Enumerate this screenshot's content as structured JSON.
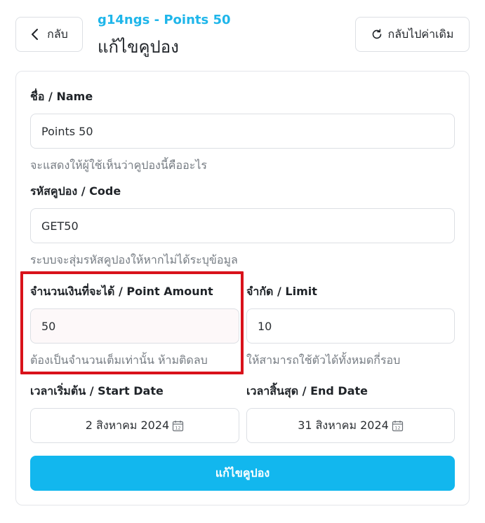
{
  "header": {
    "back_label": "กลับ",
    "breadcrumb": "g14ngs - Points 50",
    "title": "แก้ไขคูปอง",
    "reset_label": "กลับไปค่าเดิม"
  },
  "form": {
    "name": {
      "label": "ชื่อ / Name",
      "value": "Points 50",
      "hint": "จะแสดงให้ผู้ใช้เห็นว่าคูปองนี้คืออะไร"
    },
    "code": {
      "label": "รหัสคูปอง / Code",
      "value": "GET50",
      "hint": "ระบบจะสุ่มรหัสคูปองให้หากไม่ได้ระบุข้อมูล"
    },
    "point_amount": {
      "label": "จำนวนเงินที่จะได้ / Point Amount",
      "value": "50",
      "hint": "ต้องเป็นจำนวนเต็มเท่านั้น ห้ามติดลบ"
    },
    "limit": {
      "label": "จำกัด / Limit",
      "value": "10",
      "hint": "ให้สามารถใช้ตัวได้ทั้งหมดกี่รอบ"
    },
    "start_date": {
      "label": "เวลาเริ่มต้น / Start Date",
      "value": "2 สิงหาคม 2024"
    },
    "end_date": {
      "label": "เวลาสิ้นสุด / End Date",
      "value": "31 สิงหาคม 2024"
    },
    "submit_label": "แก้ไขคูปอง"
  },
  "colors": {
    "accent": "#12b7ee",
    "breadcrumb": "#1fb6ea",
    "highlight": "#d9121b"
  },
  "icons": [
    "chevron-left-icon",
    "refresh-icon",
    "calendar-icon"
  ]
}
